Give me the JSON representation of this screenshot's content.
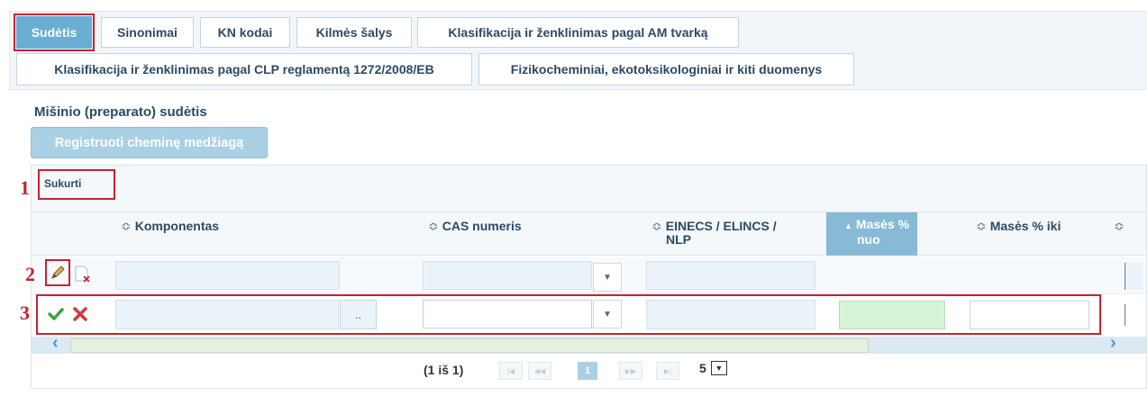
{
  "tabs_row1": [
    "Sudėtis",
    "Sinonimai",
    "KN kodai",
    "Kilmės šalys",
    "Klasifikacija ir ženklinimas pagal AM tvarką"
  ],
  "tabs_row2": [
    "Klasifikacija ir ženklinimas pagal CLP reglamentą 1272/2008/EB",
    "Fizikocheminiai, ekotoksikologiniai ir kiti duomenys"
  ],
  "section_title": "Mišinio (preparato) sudėtis",
  "register_button": "Registruoti cheminę medžiagą",
  "create_label": "Sukurti",
  "columns": {
    "sort_glyph": "≎",
    "sort_active_glyph": "▲",
    "komponentas": "Komponentas",
    "cas": "CAS numeris",
    "einecs_line1": "EINECS / ELINCS /",
    "einecs_line2": "NLP",
    "mases_nuo_line1": "Masės %",
    "mases_nuo_line2": "nuo",
    "mases_iki": "Masės % iki"
  },
  "markers": [
    "1",
    "2",
    "3"
  ],
  "row_editor": {
    "dots_label": ".."
  },
  "paginator": {
    "info": "(1 iš 1)",
    "current_page": "1",
    "rows_per_page": "5"
  },
  "colors": {
    "accent": "#6aaed3",
    "highlight_red": "#c4242f",
    "heading": "#2d4a63"
  }
}
